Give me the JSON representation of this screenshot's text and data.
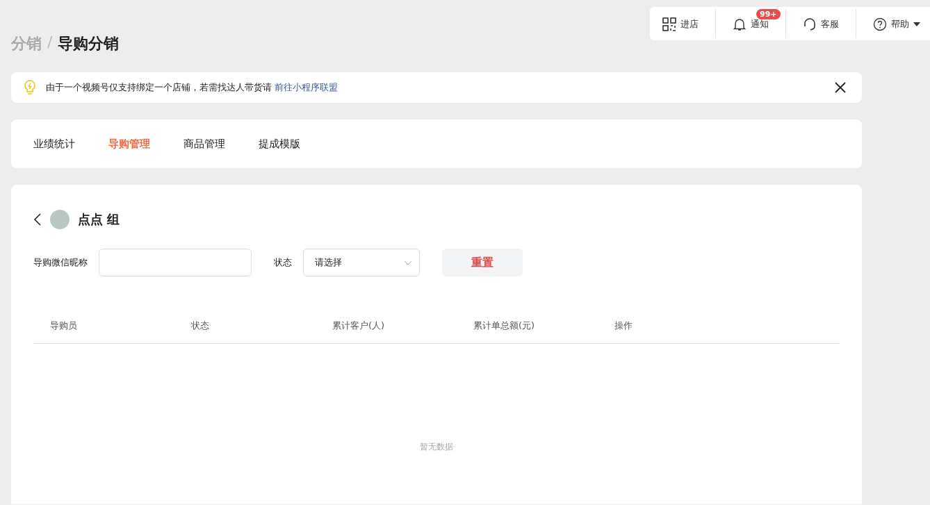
{
  "breadcrumb": {
    "parent": "分销",
    "separator": "/",
    "current": "导购分销"
  },
  "toolbar": [
    {
      "kind": "qr",
      "label": "进店"
    },
    {
      "kind": "bell",
      "label": "通知",
      "badge": "99+"
    },
    {
      "kind": "headset",
      "label": "客服"
    },
    {
      "kind": "help",
      "label": "帮助"
    }
  ],
  "notice": {
    "text": "由于一个视频号仅支持绑定一个店铺，若需找达人带货请",
    "link": "前往小程序联盟"
  },
  "tabs": [
    {
      "label": "业绩统计",
      "selected": false
    },
    {
      "label": "导购管理",
      "selected": true
    },
    {
      "label": "商品管理",
      "selected": false
    },
    {
      "label": "提成模版",
      "selected": false
    }
  ],
  "group": {
    "name": "点点 组"
  },
  "filters": {
    "nickname_label": "导购微信昵称",
    "status_label": "状态",
    "status_placeholder": "请选择",
    "reset": "重置"
  },
  "table": {
    "columns": [
      "导购员",
      "状态",
      "累计客户(人)",
      "累计单总额(元)",
      "操作"
    ],
    "empty": "暂无数据"
  }
}
